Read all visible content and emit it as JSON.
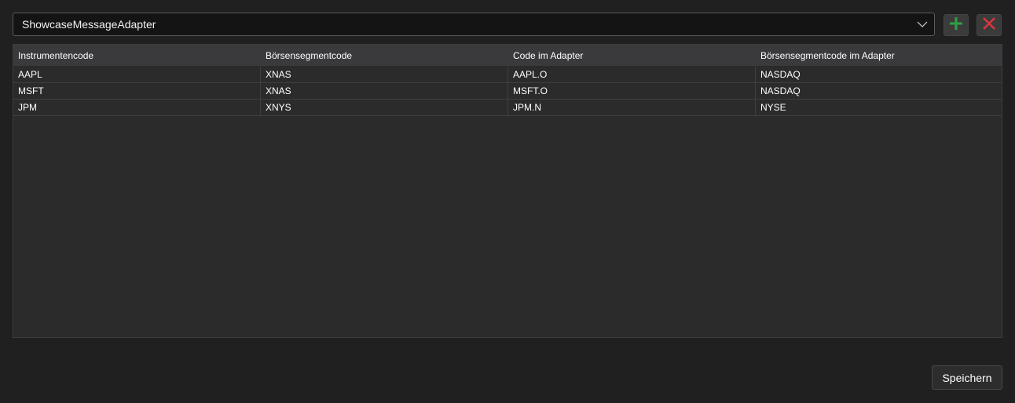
{
  "adapter_selector": {
    "selected": "ShowcaseMessageAdapter",
    "chevron_icon": "chevron-down-icon"
  },
  "toolbar": {
    "add_icon": "plus-icon",
    "add_color": "#2ea043",
    "remove_icon": "close-icon",
    "remove_color": "#d9363e"
  },
  "grid": {
    "columns": [
      "Instrumentencode",
      "Börsensegmentcode",
      "Code im Adapter",
      "Börsensegmentcode im Adapter"
    ],
    "rows": [
      [
        "AAPL",
        "XNAS",
        "AAPL.O",
        "NASDAQ"
      ],
      [
        "MSFT",
        "XNAS",
        "MSFT.O",
        "NASDAQ"
      ],
      [
        "JPM",
        "XNYS",
        "JPM.N",
        "NYSE"
      ]
    ]
  },
  "footer": {
    "save_label": "Speichern"
  }
}
